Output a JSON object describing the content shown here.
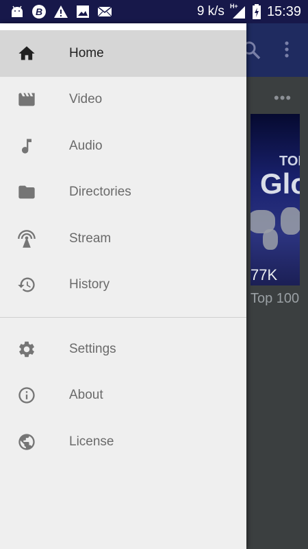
{
  "status_bar": {
    "speed": "9 k/s",
    "network": "H+",
    "time": "15:39",
    "icons": [
      "android-icon",
      "b-badge-icon",
      "warning-icon",
      "image-icon",
      "mail-icon",
      "signal-icon",
      "battery-charging-icon"
    ]
  },
  "drawer": {
    "primary_items": [
      {
        "label": "Home",
        "icon": "home-icon",
        "active": true
      },
      {
        "label": "Video",
        "icon": "video-icon",
        "active": false
      },
      {
        "label": "Audio",
        "icon": "music-note-icon",
        "active": false
      },
      {
        "label": "Directories",
        "icon": "folder-icon",
        "active": false
      },
      {
        "label": "Stream",
        "icon": "antenna-icon",
        "active": false
      },
      {
        "label": "History",
        "icon": "history-icon",
        "active": false
      }
    ],
    "secondary_items": [
      {
        "label": "Settings",
        "icon": "gear-icon"
      },
      {
        "label": "About",
        "icon": "info-icon"
      },
      {
        "label": "License",
        "icon": "globe-icon"
      }
    ]
  },
  "background_app": {
    "more_dots": "•••",
    "thumbnail_text_1": "TOP",
    "thumbnail_text_2": "Glo",
    "views": "77K",
    "caption": "Top 100"
  },
  "colors": {
    "status_bar": "#17184a",
    "toolbar": "#1f2b60",
    "drawer_bg": "#efefef",
    "active_item_bg": "#d6d6d6",
    "icon_grey": "#757575"
  }
}
